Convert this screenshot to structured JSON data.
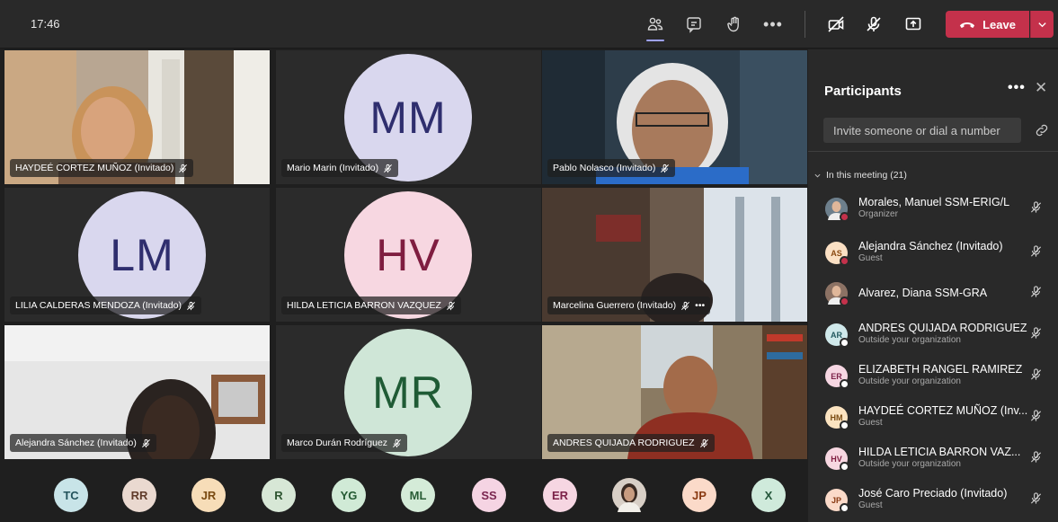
{
  "topbar": {
    "time": "17:46",
    "leave_label": "Leave",
    "icons": [
      "people-icon",
      "chat-icon",
      "raise-hand-icon",
      "more-icon",
      "camera-off-icon",
      "mic-off-icon",
      "share-icon",
      "phone-icon"
    ]
  },
  "tiles": [
    {
      "name": "HAYDEÉ CORTEZ MUÑOZ (Invitado)",
      "type": "video"
    },
    {
      "name": "Mario Marin (Invitado)",
      "type": "avatar",
      "initials": "MM",
      "bg": "#d9d7ee",
      "fg": "#2f2e6e"
    },
    {
      "name": "Pablo Nolasco (Invitado)",
      "type": "video"
    },
    {
      "name": "LILIA CALDERAS MENDOZA (Invitado)",
      "type": "avatar",
      "initials": "LM",
      "bg": "#d9d7ee",
      "fg": "#2f2e6e"
    },
    {
      "name": "HILDA LETICIA BARRON VAZQUEZ",
      "type": "avatar",
      "initials": "HV",
      "bg": "#f7d7e1",
      "fg": "#7f1d40"
    },
    {
      "name": "Marcelina Guerrero (Invitado)",
      "type": "video",
      "more": "•••"
    },
    {
      "name": "Alejandra Sánchez (Invitado)",
      "type": "video"
    },
    {
      "name": "Marco Durán Rodríguez",
      "type": "avatar",
      "initials": "MR",
      "bg": "#cfe6d7",
      "fg": "#1f5b35"
    },
    {
      "name": "ANDRES QUIJADA RODRIGUEZ",
      "type": "video"
    }
  ],
  "bottom_avatars": [
    {
      "initials": "TC",
      "bg": "#c8e4e8",
      "fg": "#24535c"
    },
    {
      "initials": "RR",
      "bg": "#ead9d0",
      "fg": "#603b2a"
    },
    {
      "initials": "JR",
      "bg": "#f7ddb8",
      "fg": "#7a4b12"
    },
    {
      "initials": "R",
      "bg": "#d7e7d6",
      "fg": "#2e5531"
    },
    {
      "initials": "YG",
      "bg": "#d0ead6",
      "fg": "#245a33"
    },
    {
      "initials": "ML",
      "bg": "#d4ebd8",
      "fg": "#2a5e37"
    },
    {
      "initials": "SS",
      "bg": "#f5d4e3",
      "fg": "#7b2650"
    },
    {
      "initials": "ER",
      "bg": "#f6d6e2",
      "fg": "#7c2249"
    },
    {
      "initials": "",
      "bg": "#7e6a5d",
      "fg": "#fff",
      "photo": true
    },
    {
      "initials": "JP",
      "bg": "#fbdac9",
      "fg": "#8a3a12"
    },
    {
      "initials": "X",
      "bg": "#cfeadb",
      "fg": "#24563a"
    }
  ],
  "panel": {
    "title": "Participants",
    "more": "•••",
    "close": "✕",
    "invite_placeholder": "Invite someone or dial a number",
    "meeting_header": "In this meeting (21)",
    "participants": [
      {
        "name": "Morales, Manuel SSM-ERIG/L",
        "role": "Organizer",
        "initials": "",
        "bg": "#6d7f8c",
        "status": "#c4314b",
        "photo": true
      },
      {
        "name": "Alejandra Sánchez (Invitado)",
        "role": "Guest",
        "initials": "AS",
        "bg": "#fbe0c4",
        "fg": "#8a4a12",
        "status": "#c4314b"
      },
      {
        "name": "Alvarez, Diana SSM-GRA",
        "role": "",
        "initials": "",
        "bg": "#8c7264",
        "status": "#c4314b",
        "photo": true
      },
      {
        "name": "ANDRES QUIJADA RODRIGUEZ",
        "role": "Outside your organization",
        "initials": "AR",
        "bg": "#cfe8ea",
        "fg": "#245a60",
        "status": "#ffffff"
      },
      {
        "name": "ELIZABETH RANGEL RAMIREZ",
        "role": "Outside your organization",
        "initials": "ER",
        "bg": "#f6d6e2",
        "fg": "#7c2249",
        "status": "#ffffff"
      },
      {
        "name": "HAYDEÉ CORTEZ MUÑOZ (Inv...",
        "role": "Guest",
        "initials": "HM",
        "bg": "#fbe3c0",
        "fg": "#7a4b12",
        "status": "#ffffff"
      },
      {
        "name": "HILDA LETICIA BARRON VAZ...",
        "role": "Outside your organization",
        "initials": "HV",
        "bg": "#f7d7e1",
        "fg": "#7f1d40",
        "status": "#ffffff"
      },
      {
        "name": "José Caro Preciado (Invitado)",
        "role": "Guest",
        "initials": "JP",
        "bg": "#fbdac9",
        "fg": "#8a3a12",
        "status": "#ffffff"
      }
    ]
  }
}
